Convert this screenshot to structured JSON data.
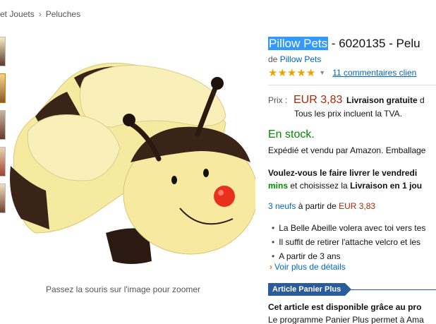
{
  "breadcrumb": {
    "items": [
      "et Jouets",
      "Peluches"
    ],
    "separator": "›"
  },
  "product": {
    "brand": "Pillow Pets",
    "title_rest": " - 6020135 - Pelu",
    "byline_prefix": "de",
    "byline_brand": "Pillow Pets",
    "rating_stars": 5,
    "reviews_label": "11 commentaires clien"
  },
  "image": {
    "zoom_hint": "Passez la souris sur l'image pour zoomer"
  },
  "price": {
    "label": "Prix :",
    "value": "EUR 3,83",
    "shipping": "Livraison gratuite",
    "shipping_suffix": " d",
    "vat_note": "Tous les prix incluent la TVA."
  },
  "stock": {
    "status": "En stock.",
    "sold_by": "Expédié et vendu par Amazon. Emballage"
  },
  "delivery": {
    "line1": "Voulez-vous le faire livrer le vendredi",
    "line2_green": "mins",
    "line2_text": " et choisissez la ",
    "line2_bold": "Livraison en 1 jou"
  },
  "offers": {
    "count_link": "3 neufs",
    "text": " à partir de ",
    "price": "EUR 3,83"
  },
  "bullets": [
    "La Belle Abeille volera avec toi vers tes",
    "Il suffit de retirer l'attache velcro et les",
    "A partir de 3 ans"
  ],
  "more_details": "Voir plus de détails",
  "panier_plus": {
    "badge": "Article Panier Plus",
    "heading": "Cet article est disponible grâce au pro",
    "text": "Le programme Panier Plus permet à Ama"
  },
  "colors": {
    "accent": "#e77600",
    "link": "#0066c0",
    "price": "#b12704",
    "stock": "#008a00",
    "badge": "#2a5b9b"
  }
}
